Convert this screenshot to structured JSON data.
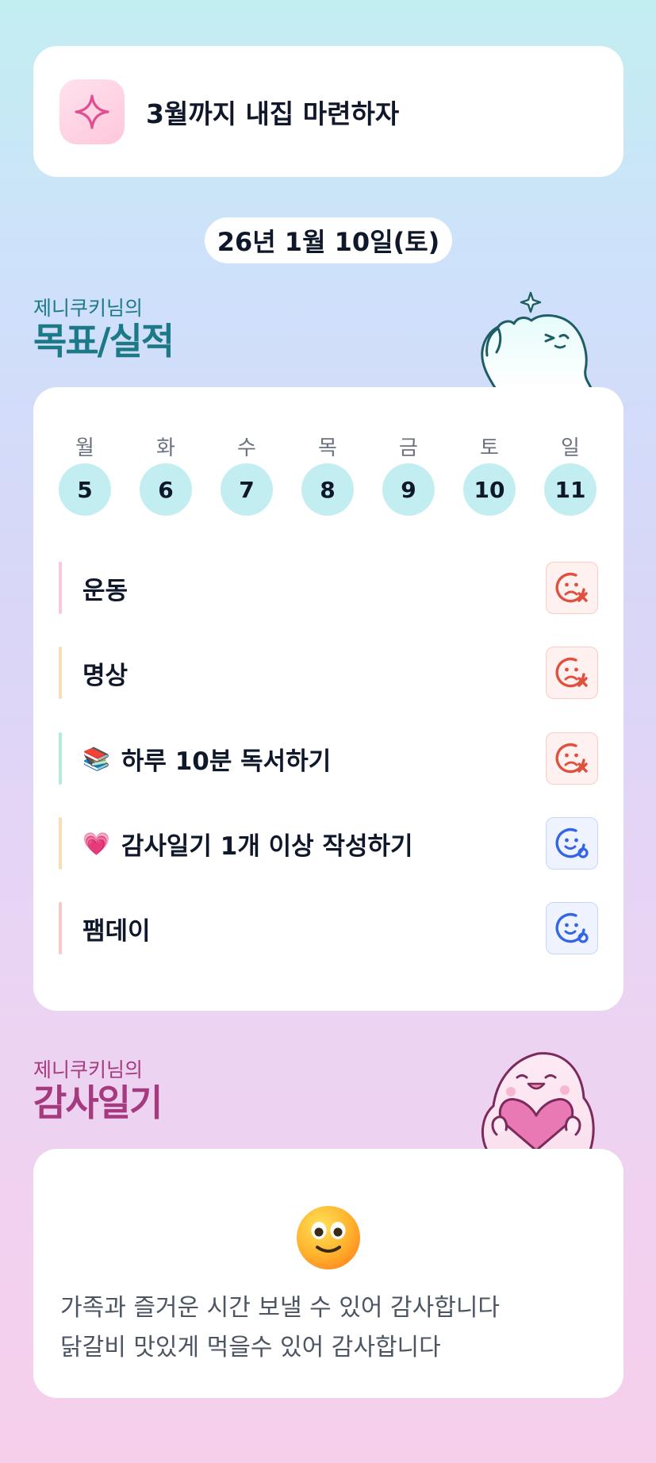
{
  "goal": {
    "text": "3월까지 내집 마련하자",
    "icon": "sparkle-icon"
  },
  "date": "26년 1월 10일(토)",
  "goals_section": {
    "subtitle": "제니쿠키님의",
    "title": "목표/실적"
  },
  "week": {
    "days": [
      {
        "label": "월",
        "num": "5"
      },
      {
        "label": "화",
        "num": "6"
      },
      {
        "label": "수",
        "num": "7"
      },
      {
        "label": "목",
        "num": "8"
      },
      {
        "label": "금",
        "num": "9"
      },
      {
        "label": "토",
        "num": "10"
      },
      {
        "label": "일",
        "num": "11"
      }
    ]
  },
  "habits": [
    {
      "label": "운동",
      "emoji": "",
      "status": "fail",
      "bar_color": "#f9c7df"
    },
    {
      "label": "명상",
      "emoji": "",
      "status": "fail",
      "bar_color": "#fbdcb4"
    },
    {
      "label": "하루 10분 독서하기",
      "emoji": "📚",
      "status": "fail",
      "bar_color": "#b4ecd6"
    },
    {
      "label": "감사일기 1개 이상 작성하기",
      "emoji": "💗",
      "status": "done",
      "bar_color": "#fbdcb4"
    },
    {
      "label": "팸데이",
      "emoji": "",
      "status": "done",
      "bar_color": "#f8c9c9"
    }
  ],
  "diary_section": {
    "subtitle": "제니쿠키님의",
    "title": "감사일기"
  },
  "diary": {
    "icon": "smiling-face-icon",
    "lines": [
      "가족과 즐거운 시간 보낼 수 있어 감사합니다",
      "닭갈비 맛있게 먹을수 있어 감사합니다"
    ]
  },
  "colors": {
    "goals_accent": "#1c7a88",
    "diary_accent": "#a53a7f",
    "fail": "#e0503f",
    "done": "#3366e6",
    "day_circle": "#c3eef1"
  }
}
